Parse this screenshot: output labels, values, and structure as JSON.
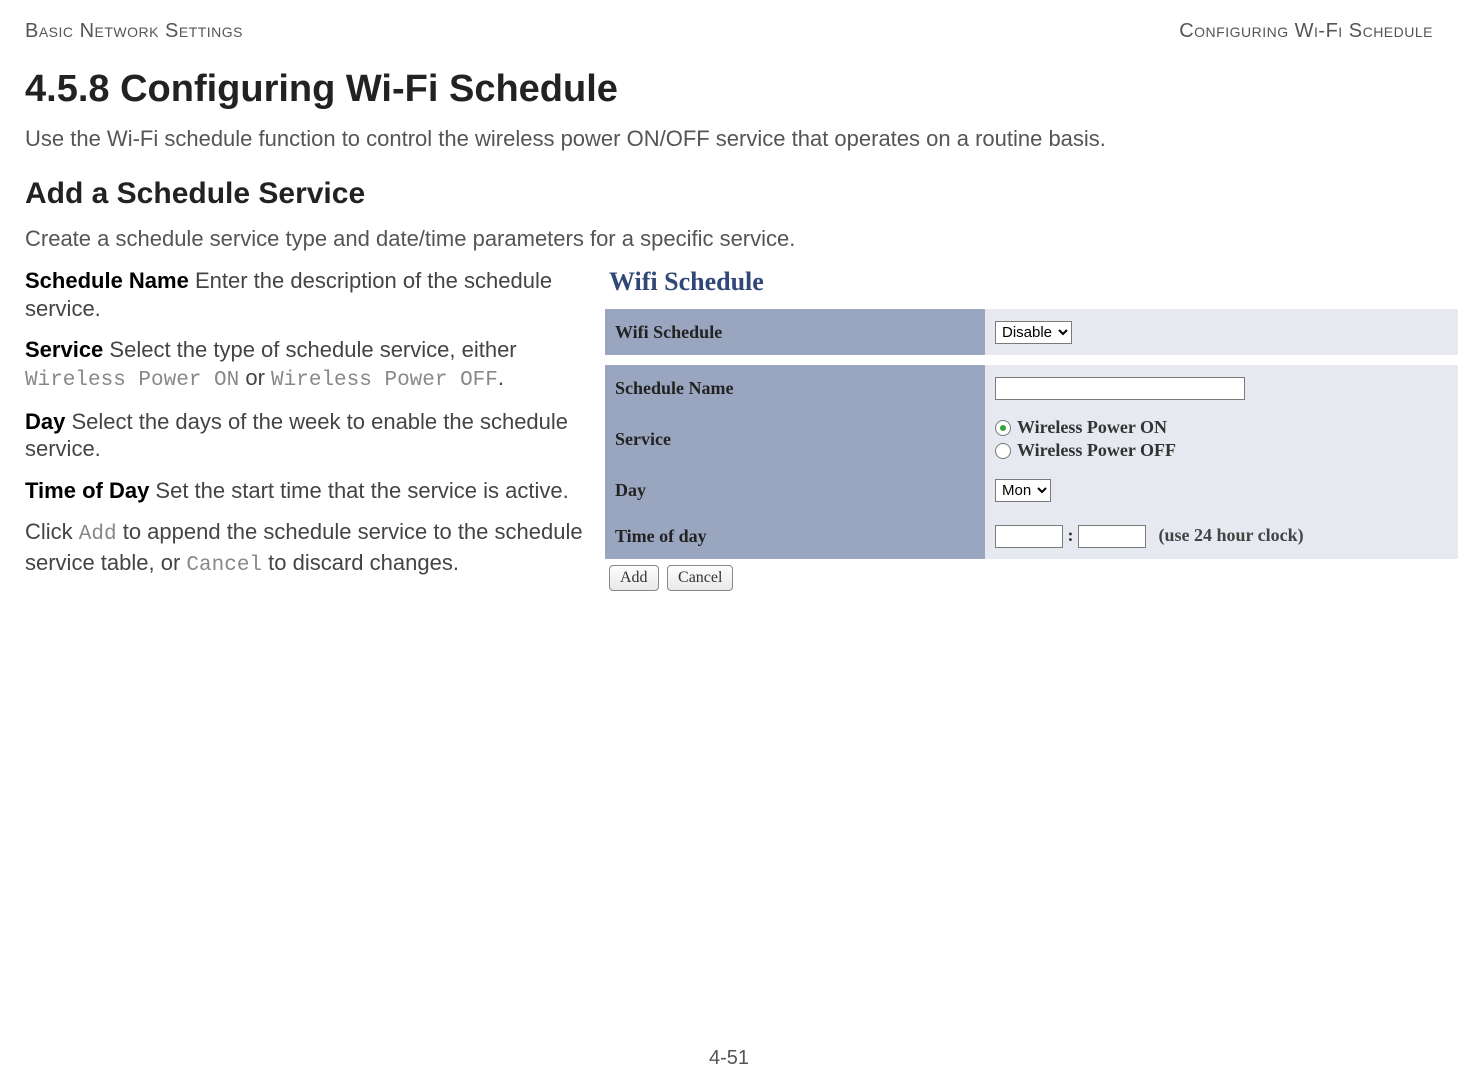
{
  "header": {
    "left": "Basic Network Settings",
    "right": "Configuring Wi-Fi Schedule"
  },
  "section": {
    "number_title": "4.5.8 Configuring Wi-Fi Schedule",
    "intro": "Use the Wi-Fi schedule function to control the wireless power ON/OFF service that operates on a routine basis."
  },
  "subsection": {
    "title": "Add a Schedule Service",
    "intro": "Create a schedule service type and date/time parameters for a specific service."
  },
  "descriptions": {
    "schedule_name": {
      "label": "Schedule Name",
      "text": " Enter the description of the schedule service."
    },
    "service": {
      "label": "Service",
      "pre": " Select the type of schedule service, either ",
      "opt1": "Wireless Power ON",
      "mid": " or ",
      "opt2": "Wireless Power OFF",
      "post": "."
    },
    "day": {
      "label": "Day",
      "text": " Select the days of the week to enable the schedule service."
    },
    "time": {
      "label": "Time of Day",
      "text": " Set the start time that the service is active."
    },
    "click": {
      "pre": "Click ",
      "btn1": "Add",
      "mid": " to append the schedule service to the schedule service table, or ",
      "btn2": "Cancel",
      "post": " to discard changes."
    }
  },
  "panel": {
    "title": "Wifi Schedule",
    "rows": {
      "wifi_schedule": {
        "label": "Wifi Schedule",
        "select": "Disable"
      },
      "schedule_name": {
        "label": "Schedule Name",
        "value": ""
      },
      "service": {
        "label": "Service",
        "on": "Wireless Power ON",
        "off": "Wireless Power OFF",
        "checked": "on"
      },
      "day": {
        "label": "Day",
        "select": "Mon"
      },
      "time": {
        "label": "Time of day",
        "hour": "",
        "minute": "",
        "hint": "(use 24 hour clock)"
      }
    },
    "buttons": {
      "add": "Add",
      "cancel": "Cancel"
    }
  },
  "footer": "4-51"
}
